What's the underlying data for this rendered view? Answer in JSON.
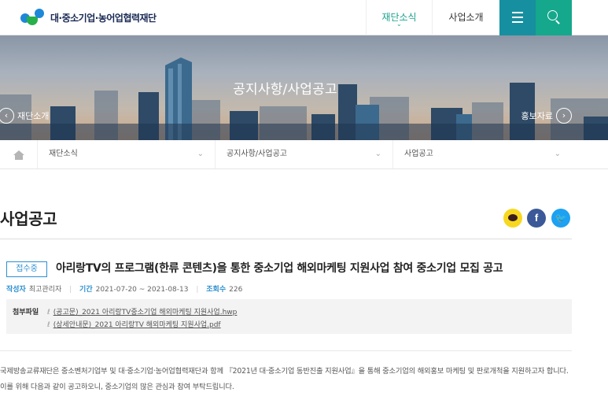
{
  "header": {
    "logo_text": "대·중소기업·농어업협력재단",
    "nav": [
      {
        "label": "재단소식",
        "active": true
      },
      {
        "label": "사업소개",
        "active": false
      }
    ],
    "menu_icon": "hamburger-icon",
    "search_icon": "search-icon"
  },
  "hero": {
    "title": "공지사항/사업공고",
    "prev_label": "재단소개",
    "next_label": "홍보자료"
  },
  "breadcrumb": {
    "home_icon": "home-icon",
    "items": [
      "재단소식",
      "공지사항/사업공고",
      "사업공고"
    ]
  },
  "page": {
    "title": "사업공고"
  },
  "share": {
    "kakao_icon": "kakaotalk-icon",
    "facebook_glyph": "f",
    "twitter_glyph": "🐦"
  },
  "post": {
    "status": "접수중",
    "title": "아리랑TV의 프로그램(한류 콘텐츠)을 통한 중소기업 해외마케팅 지원사업 참여 중소기업 모집 공고",
    "meta": {
      "author_label": "작성자",
      "author": "최고관리자",
      "period_label": "기간",
      "period": "2021-07-20 ~ 2021-08-13",
      "views_label": "조회수",
      "views": "226"
    },
    "attachments_label": "첨부파일",
    "attachments": [
      "(공고문)_2021 아리랑TV중소기업 해외마케팅 지원사업.hwp",
      "(상세안내문)_2021 아리랑TV 해외마케팅 지원사업.pdf"
    ],
    "body": "국제방송교류재단은 중소벤처기업부 및 대·중소기업·농어업협력재단과 함께 『2021년 대·중소기업 동반진출 지원사업』을 통해 중소기업의 해외홍보 마케팅 및 판로개척을 지원하고자 합니다. 이를 위해 다음과 같이 공고하오니, 중소기업의 많은 관심과 참여 부탁드립니다."
  },
  "colors": {
    "accent_teal": "#1aa38f",
    "menu_bg": "#168fa0",
    "search_bg": "#15a88c",
    "link_blue": "#2c8fd0"
  }
}
